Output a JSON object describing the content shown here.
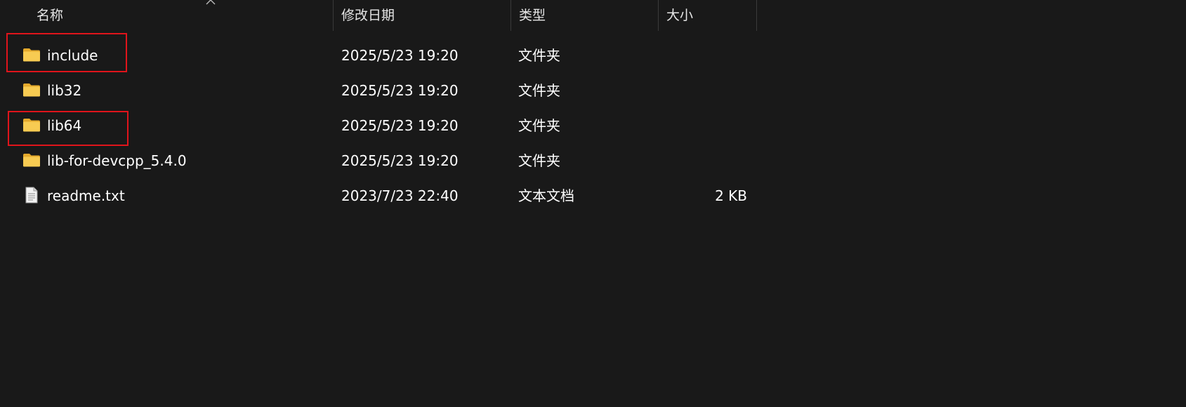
{
  "columns": {
    "name": "名称",
    "date": "修改日期",
    "type": "类型",
    "size": "大小"
  },
  "files": [
    {
      "name": "include",
      "date": "2025/5/23 19:20",
      "type": "文件夹",
      "size": "",
      "icon": "folder-icon",
      "highlighted": true
    },
    {
      "name": "lib32",
      "date": "2025/5/23 19:20",
      "type": "文件夹",
      "size": "",
      "icon": "folder-icon",
      "highlighted": false
    },
    {
      "name": "lib64",
      "date": "2025/5/23 19:20",
      "type": "文件夹",
      "size": "",
      "icon": "folder-icon",
      "highlighted": true
    },
    {
      "name": "lib-for-devcpp_5.4.0",
      "date": "2025/5/23 19:20",
      "type": "文件夹",
      "size": "",
      "icon": "folder-icon",
      "highlighted": false
    },
    {
      "name": "readme.txt",
      "date": "2023/7/23 22:40",
      "type": "文本文档",
      "size": "2 KB",
      "icon": "text-file-icon",
      "highlighted": false
    }
  ],
  "colors": {
    "background": "#191919",
    "text": "#ffffff",
    "highlight": "#e0141b",
    "folder": "#f6c646"
  }
}
